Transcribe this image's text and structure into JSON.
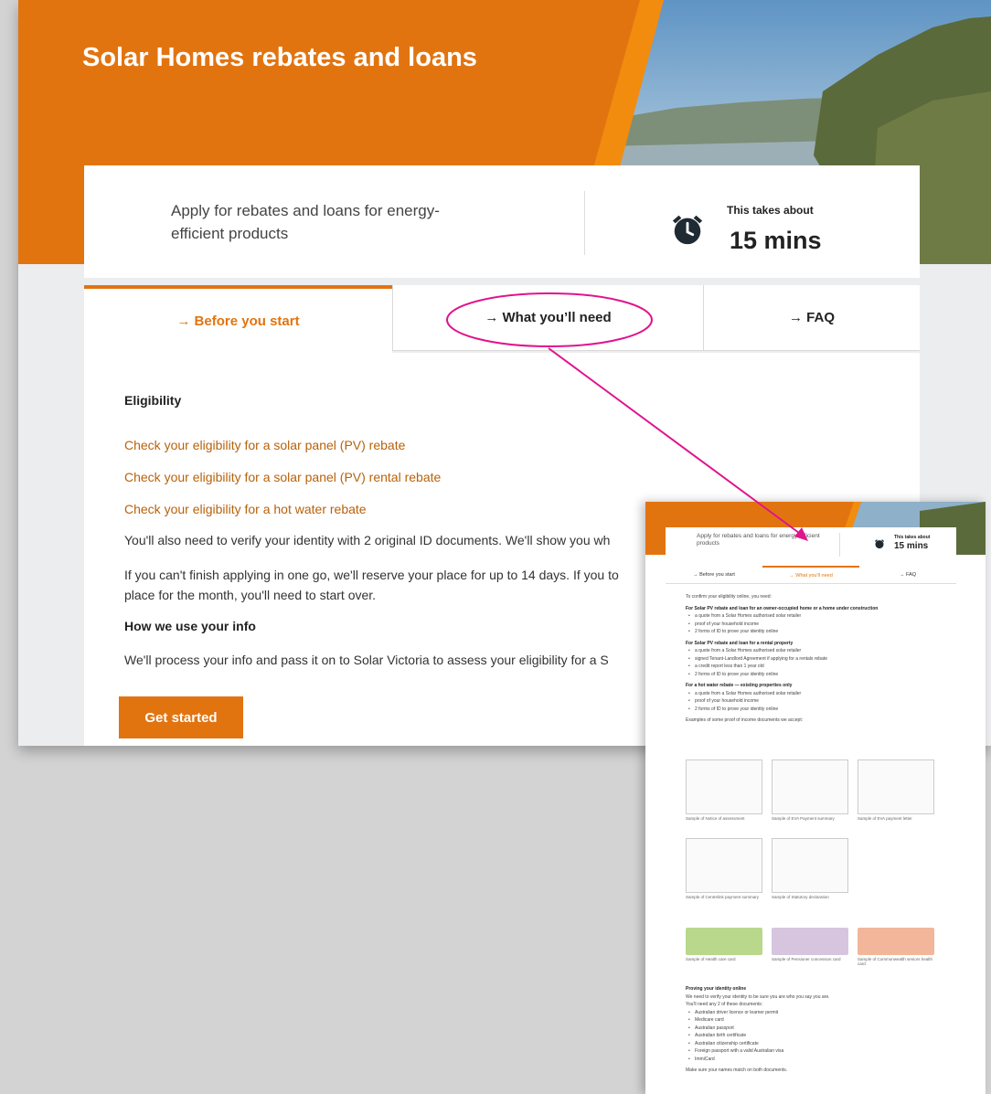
{
  "hero": {
    "title": "Solar Homes rebates and loans"
  },
  "info": {
    "description": "Apply for rebates and loans for energy-efficient products",
    "takes_label": "This takes about",
    "takes_value": "15 mins"
  },
  "tabs": [
    {
      "label": "→ Before you start",
      "active": true
    },
    {
      "label": "→ What you’ll need",
      "active": false
    },
    {
      "label": "→ FAQ",
      "active": false
    }
  ],
  "content": {
    "eligibility_heading": "Eligibility",
    "links": [
      "Check your eligibility for a solar panel (PV) rebate",
      "Check your eligibility for a solar panel (PV) rental rebate",
      "Check your eligibility for a hot water rebate"
    ],
    "para_id": "You'll also need to verify your identity with 2 original ID documents. We'll show you wh",
    "para_save_1": "If you can't finish applying in one go, we'll reserve your place for up to 14 days. If you to",
    "para_save_2": "place for the month, you'll need to start over.",
    "info_heading": "How we use your info",
    "para_info": "We'll process your info and pass it on to Solar Victoria to assess your eligibility for a S",
    "button": "Get started"
  },
  "colors": {
    "brand_orange": "#e27410",
    "link": "#b8620b",
    "annotation": "#e0148c"
  },
  "icons": [
    "alarm-clock-icon"
  ]
}
